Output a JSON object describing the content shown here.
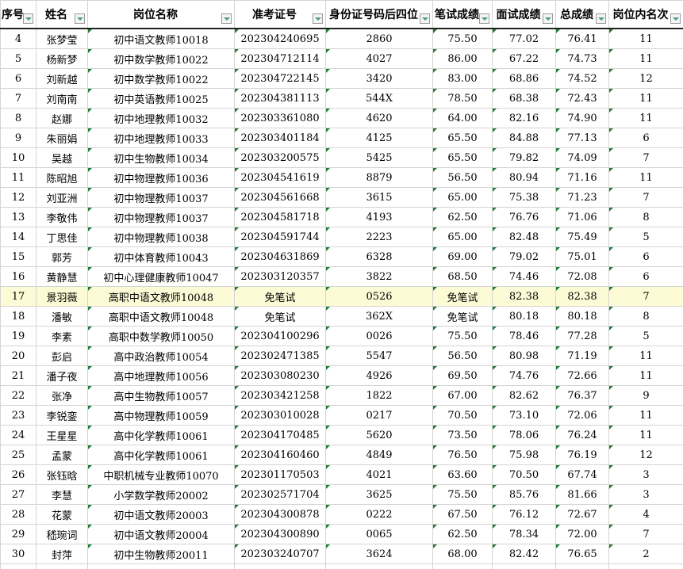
{
  "headers": [
    "序号",
    "姓名",
    "岗位名称",
    "准考证号",
    "身份证号码后四位",
    "笔试成绩",
    "面试成绩",
    "总成绩",
    "岗位内名次"
  ],
  "header_labels": [
    "序号",
    "姓名",
    "岗位名称",
    "准考证号",
    "身份证号码后四位",
    "笔试成绩",
    "面试成绩",
    "总成绩",
    "岗位内名次"
  ],
  "colors": {
    "highlight_row": "#fdfbd6",
    "filter_arrow": "#4a9b8e",
    "cell_flag": "#1e7b3a"
  },
  "rows": [
    {
      "no": "4",
      "name": "张梦莹",
      "post": "初中语文教师10018",
      "ticket": "202304240695",
      "id4": "2860",
      "written": "75.50",
      "interview": "77.02",
      "total": "76.41",
      "rank": "11"
    },
    {
      "no": "5",
      "name": "杨新梦",
      "post": "初中数学教师10022",
      "ticket": "202304712114",
      "id4": "4027",
      "written": "86.00",
      "interview": "67.22",
      "total": "74.73",
      "rank": "11"
    },
    {
      "no": "6",
      "name": "刘新越",
      "post": "初中数学教师10022",
      "ticket": "202304722145",
      "id4": "3420",
      "written": "83.00",
      "interview": "68.86",
      "total": "74.52",
      "rank": "12"
    },
    {
      "no": "7",
      "name": "刘南南",
      "post": "初中英语教师10025",
      "ticket": "202304381113",
      "id4": "544X",
      "written": "78.50",
      "interview": "68.38",
      "total": "72.43",
      "rank": "11"
    },
    {
      "no": "8",
      "name": "赵娜",
      "post": "初中地理教师10032",
      "ticket": "202303361080",
      "id4": "4620",
      "written": "64.00",
      "interview": "82.16",
      "total": "74.90",
      "rank": "11"
    },
    {
      "no": "9",
      "name": "朱丽娟",
      "post": "初中地理教师10033",
      "ticket": "202303401184",
      "id4": "4125",
      "written": "65.50",
      "interview": "84.88",
      "total": "77.13",
      "rank": "6"
    },
    {
      "no": "10",
      "name": "吴越",
      "post": "初中生物教师10034",
      "ticket": "202303200575",
      "id4": "5425",
      "written": "65.50",
      "interview": "79.82",
      "total": "74.09",
      "rank": "7"
    },
    {
      "no": "11",
      "name": "陈昭旭",
      "post": "初中物理教师10036",
      "ticket": "202304541619",
      "id4": "8879",
      "written": "56.50",
      "interview": "80.94",
      "total": "71.16",
      "rank": "11"
    },
    {
      "no": "12",
      "name": "刘亚洲",
      "post": "初中物理教师10037",
      "ticket": "202304561668",
      "id4": "3615",
      "written": "65.00",
      "interview": "75.38",
      "total": "71.23",
      "rank": "7"
    },
    {
      "no": "13",
      "name": "李敬伟",
      "post": "初中物理教师10037",
      "ticket": "202304581718",
      "id4": "4193",
      "written": "62.50",
      "interview": "76.76",
      "total": "71.06",
      "rank": "8"
    },
    {
      "no": "14",
      "name": "丁思佳",
      "post": "初中物理教师10038",
      "ticket": "202304591744",
      "id4": "2223",
      "written": "65.00",
      "interview": "82.48",
      "total": "75.49",
      "rank": "5"
    },
    {
      "no": "15",
      "name": "郭芳",
      "post": "初中体育教师10043",
      "ticket": "202304631869",
      "id4": "6328",
      "written": "69.00",
      "interview": "79.02",
      "total": "75.01",
      "rank": "6"
    },
    {
      "no": "16",
      "name": "黄静慧",
      "post": "初中心理健康教师10047",
      "ticket": "202303120357",
      "id4": "3822",
      "written": "68.50",
      "interview": "74.46",
      "total": "72.08",
      "rank": "6"
    },
    {
      "no": "17",
      "name": "景羽薇",
      "post": "高职中语文教师10048",
      "ticket": "免笔试",
      "id4": "0526",
      "written": "免笔试",
      "interview": "82.38",
      "total": "82.38",
      "rank": "7"
    },
    {
      "no": "18",
      "name": "潘敏",
      "post": "高职中语文教师10048",
      "ticket": "免笔试",
      "id4": "362X",
      "written": "免笔试",
      "interview": "80.18",
      "total": "80.18",
      "rank": "8"
    },
    {
      "no": "19",
      "name": "李素",
      "post": "高职中数学教师10050",
      "ticket": "202304100296",
      "id4": "0026",
      "written": "75.50",
      "interview": "78.46",
      "total": "77.28",
      "rank": "5"
    },
    {
      "no": "20",
      "name": "彭启",
      "post": "高中政治教师10054",
      "ticket": "202302471385",
      "id4": "5547",
      "written": "56.50",
      "interview": "80.98",
      "total": "71.19",
      "rank": "11"
    },
    {
      "no": "21",
      "name": "潘子夜",
      "post": "高中地理教师10056",
      "ticket": "202303080230",
      "id4": "4926",
      "written": "69.50",
      "interview": "74.76",
      "total": "72.66",
      "rank": "11"
    },
    {
      "no": "22",
      "name": "张净",
      "post": "高中生物教师10057",
      "ticket": "202303421258",
      "id4": "1822",
      "written": "67.00",
      "interview": "82.62",
      "total": "76.37",
      "rank": "9"
    },
    {
      "no": "23",
      "name": "李锐銮",
      "post": "高中物理教师10059",
      "ticket": "202303010028",
      "id4": "0217",
      "written": "70.50",
      "interview": "73.10",
      "total": "72.06",
      "rank": "11"
    },
    {
      "no": "24",
      "name": "王星星",
      "post": "高中化学教师10061",
      "ticket": "202304170485",
      "id4": "5620",
      "written": "73.50",
      "interview": "78.06",
      "total": "76.24",
      "rank": "11"
    },
    {
      "no": "25",
      "name": "孟蒙",
      "post": "高中化学教师10061",
      "ticket": "202304160460",
      "id4": "4849",
      "written": "76.50",
      "interview": "75.98",
      "total": "76.19",
      "rank": "12"
    },
    {
      "no": "26",
      "name": "张钰晗",
      "post": "中职机械专业教师10070",
      "ticket": "202301170503",
      "id4": "4021",
      "written": "63.60",
      "interview": "70.50",
      "total": "67.74",
      "rank": "3"
    },
    {
      "no": "27",
      "name": "李慧",
      "post": "小学数学教师20002",
      "ticket": "202302571704",
      "id4": "3625",
      "written": "75.50",
      "interview": "85.76",
      "total": "81.66",
      "rank": "3"
    },
    {
      "no": "28",
      "name": "花蒙",
      "post": "初中语文教师20003",
      "ticket": "202304300878",
      "id4": "0222",
      "written": "67.50",
      "interview": "76.12",
      "total": "72.67",
      "rank": "4"
    },
    {
      "no": "29",
      "name": "嵇琬词",
      "post": "初中语文教师20004",
      "ticket": "202304300890",
      "id4": "0065",
      "written": "62.50",
      "interview": "78.34",
      "total": "72.00",
      "rank": "7"
    },
    {
      "no": "30",
      "name": "封萍",
      "post": "初中生物教师20011",
      "ticket": "202303240707",
      "id4": "3624",
      "written": "68.00",
      "interview": "82.42",
      "total": "76.65",
      "rank": "2"
    }
  ]
}
